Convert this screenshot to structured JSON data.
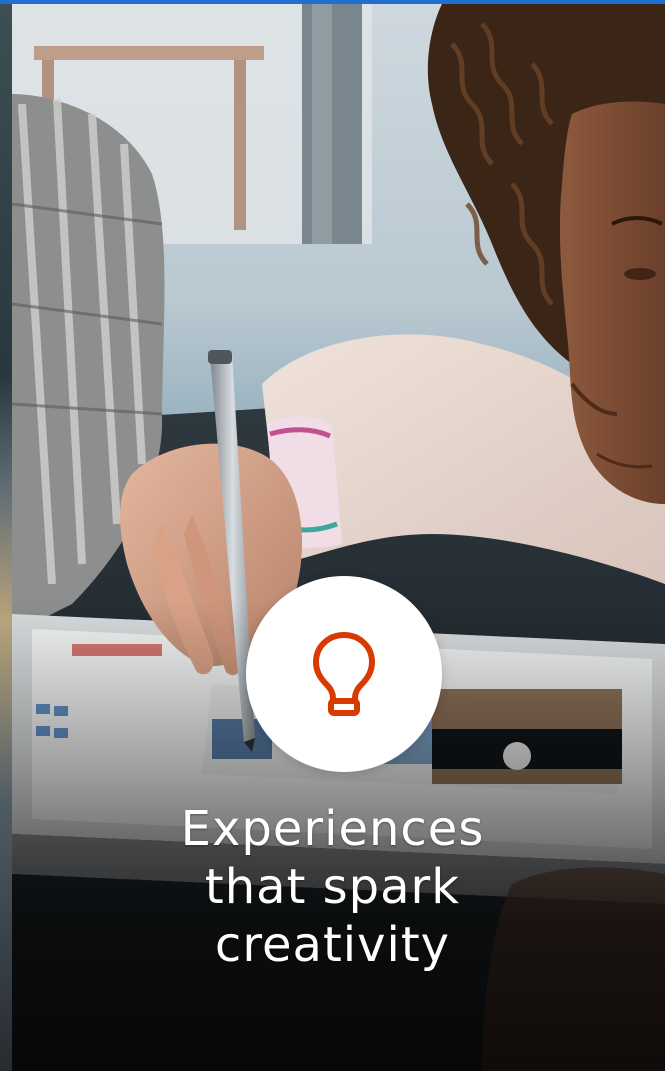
{
  "hero": {
    "headline_lines": [
      "Experiences",
      "that spark",
      "creativity"
    ],
    "icon": "lightbulb-icon",
    "icon_color": "#d83b01",
    "accent_color": "#1f6fd1"
  }
}
